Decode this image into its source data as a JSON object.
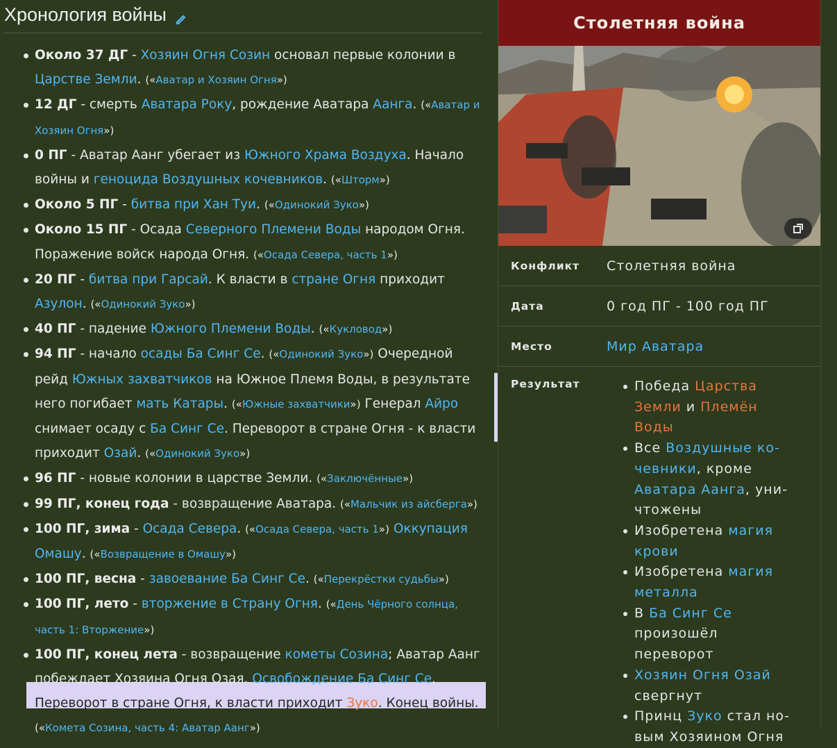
{
  "heading": "Хронология войны",
  "timeline": [
    {
      "date": "Около 37 ДГ",
      "parts": [
        {
          "t": " - "
        },
        {
          "l": "Хозяин Огня Созин"
        },
        {
          "t": " основал первые колонии в "
        },
        {
          "l": "Царстве Земли"
        },
        {
          "t": ". "
        }
      ],
      "ref": [
        "Аватар и Хозяин Огня"
      ]
    },
    {
      "date": "12 ДГ",
      "parts": [
        {
          "t": " - смерть "
        },
        {
          "l": "Аватара Року"
        },
        {
          "t": ", рождение Аватара "
        },
        {
          "l": "Аанга"
        },
        {
          "t": ". "
        }
      ],
      "ref": [
        "Аватар и Хозяин Огня"
      ]
    },
    {
      "date": "0 ПГ",
      "parts": [
        {
          "t": " - Аватар Аанг убегает из "
        },
        {
          "l": "Южного Храма Воздуха"
        },
        {
          "t": ". Начало войны и "
        },
        {
          "l": "геноцида Воздушных кочевников"
        },
        {
          "t": ". "
        }
      ],
      "ref": [
        "Шторм"
      ]
    },
    {
      "date": "Около 5 ПГ",
      "parts": [
        {
          "t": " - "
        },
        {
          "l": "битва при Хан Туи"
        },
        {
          "t": ". "
        }
      ],
      "ref": [
        "Одинокий Зуко"
      ]
    },
    {
      "date": "Около 15 ПГ",
      "parts": [
        {
          "t": " - Осада "
        },
        {
          "l": "Северного Племени Воды"
        },
        {
          "t": " народом Огня. Поражение войск народа Огня. "
        }
      ],
      "ref": [
        "Осада Севера, часть 1"
      ]
    },
    {
      "date": "20 ПГ",
      "parts": [
        {
          "t": " - "
        },
        {
          "l": "битва при Гарсай"
        },
        {
          "t": ". К власти в "
        },
        {
          "l": "стране Огня"
        },
        {
          "t": " приходит "
        },
        {
          "l": "Азулон"
        },
        {
          "t": ". "
        }
      ],
      "ref": [
        "Одинокий Зуко"
      ]
    },
    {
      "date": "40 ПГ",
      "parts": [
        {
          "t": " - падение "
        },
        {
          "l": "Южного Племени Воды"
        },
        {
          "t": ". "
        }
      ],
      "ref": [
        "Кукловод"
      ]
    },
    {
      "date": "94 ПГ",
      "parts": [
        {
          "t": " - начало "
        },
        {
          "l": "осады Ба Синг Се"
        },
        {
          "t": ". "
        },
        {
          "r": "Одинокий Зуко"
        },
        {
          "t": " Очередной рейд "
        },
        {
          "l": "Южных захватчиков"
        },
        {
          "t": " на Южное Племя Воды, в результате него погибает "
        },
        {
          "l": "мать Катары"
        },
        {
          "t": ". "
        },
        {
          "r": "Южные захватчики"
        },
        {
          "t": " Генерал "
        },
        {
          "l": "Айро"
        },
        {
          "t": " снимает осаду с "
        },
        {
          "l": "Ба Синг Се"
        },
        {
          "t": ". Переворот в стране Огня - к власти приходит "
        },
        {
          "l": "Озай"
        },
        {
          "t": ". "
        }
      ],
      "ref": [
        "Одинокий Зуко"
      ]
    },
    {
      "date": "96 ПГ",
      "parts": [
        {
          "t": " - новые колонии в царстве Земли. "
        }
      ],
      "ref": [
        "Заключённые"
      ]
    },
    {
      "date": "99 ПГ, конец года",
      "parts": [
        {
          "t": " - возвращение Аватара. "
        }
      ],
      "ref": [
        "Мальчик из айсберга"
      ]
    },
    {
      "date": "100 ПГ, зима",
      "parts": [
        {
          "t": " - "
        },
        {
          "l": "Осада Севера"
        },
        {
          "t": ". "
        },
        {
          "r": "Осада Севера, часть 1"
        },
        {
          "t": " "
        },
        {
          "l": "Оккупация Омашу"
        },
        {
          "t": ". "
        }
      ],
      "ref": [
        "Возвращение в Омашу"
      ]
    },
    {
      "date": "100 ПГ, весна",
      "parts": [
        {
          "t": " - "
        },
        {
          "l": "завоевание Ба Синг Се"
        },
        {
          "t": ". "
        }
      ],
      "ref": [
        "Перекрёстки судьбы"
      ]
    },
    {
      "date": "100 ПГ, лето",
      "parts": [
        {
          "t": " - "
        },
        {
          "l": "вторжение в Страну Огня"
        },
        {
          "t": ". "
        }
      ],
      "ref": [
        "День Чёрного солнца, часть 1: Вторжение"
      ]
    },
    {
      "date": "100 ПГ, конец лета",
      "parts": [
        {
          "t": " - возвращение "
        },
        {
          "l": "кометы Созина"
        },
        {
          "t": "; Аватар Аанг побеждает Хозяина Огня Озая. "
        },
        {
          "l": "Освобождение Ба Синг Се"
        },
        {
          "t": ". "
        },
        {
          "br": 1
        },
        {
          "t": "Переворот в стране Огня, к власти приходит "
        },
        {
          "x": "Зуко"
        },
        {
          "t": ". Конец войны. "
        }
      ],
      "ref": [
        "Комета Созина, часть 4: Аватар Аанг"
      ]
    }
  ],
  "infobox": {
    "title": "Столетняя война",
    "rows": [
      {
        "label": "Конфликт",
        "value": "Столетняя война",
        "link": false
      },
      {
        "label": "Дата",
        "value": "0 год ПГ - 100 год ПГ",
        "link": false
      },
      {
        "label": "Место",
        "value": "Мир Аватара",
        "link": true
      }
    ],
    "result_label": "Результат",
    "result_items": [
      [
        {
          "t": "Победа "
        },
        {
          "x": "Царства Земли"
        },
        {
          "t": " и "
        },
        {
          "x": "Племён Воды"
        }
      ],
      [
        {
          "t": "Все "
        },
        {
          "l": "Воздушные ко­чевники"
        },
        {
          "t": ", кроме "
        },
        {
          "l": "Аватара Аанга"
        },
        {
          "t": ", уни­чтожены"
        }
      ],
      [
        {
          "t": "Изобретена "
        },
        {
          "l": "магия крови"
        }
      ],
      [
        {
          "t": "Изобретена "
        },
        {
          "l": "магия металла"
        }
      ],
      [
        {
          "t": "В "
        },
        {
          "l": "Ба Синг Се"
        },
        {
          "t": " произо­шёл переворот"
        }
      ],
      [
        {
          "l": "Хозяин Огня Озай"
        },
        {
          "t": " свергнут"
        }
      ],
      [
        {
          "t": "Принц "
        },
        {
          "l": "Зуко"
        },
        {
          "t": " стал но­вым Хозяином Огня"
        }
      ]
    ]
  },
  "icons": {
    "edit": "pencil-icon",
    "expand": "expand-image-icon"
  },
  "colors": {
    "background": "#2d3a1e",
    "link": "#51b6f2",
    "red_link": "#e8753a",
    "title_bar": "#7a1414",
    "highlight": "#dcd4f4"
  }
}
